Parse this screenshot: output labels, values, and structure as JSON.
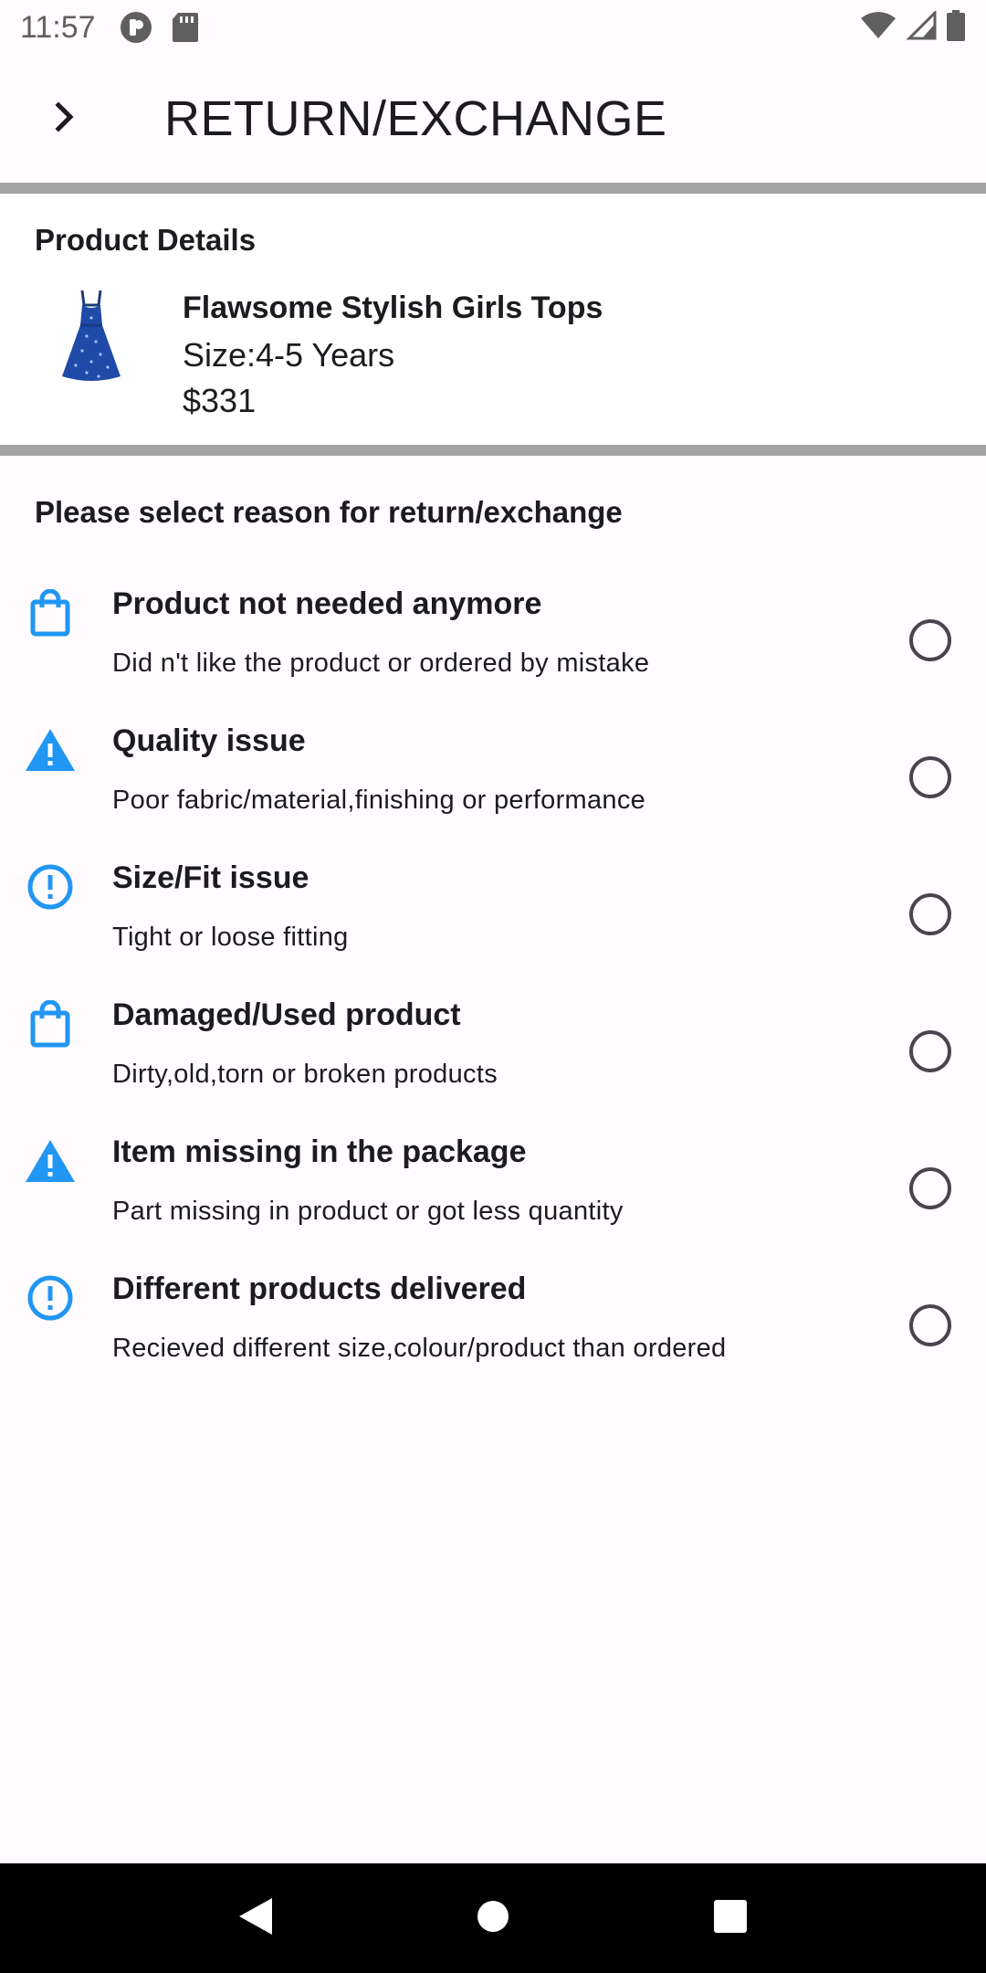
{
  "status_bar": {
    "time": "11:57",
    "icons": [
      "record-icon",
      "sd-card-icon",
      "wifi-icon",
      "signal-icon",
      "battery-icon"
    ]
  },
  "app_bar": {
    "back_icon": "chevron-right-icon",
    "title": "RETURN/EXCHANGE"
  },
  "product": {
    "heading": "Product Details",
    "name": "Flawsome Stylish Girls Tops",
    "size": "Size:4-5 Years",
    "price": "$331"
  },
  "reasons": {
    "heading": "Please select reason for return/exchange",
    "items": [
      {
        "icon": "shopping-bag-icon",
        "title": "Product not needed anymore",
        "subtitle": "Did n't like the product or ordered by mistake",
        "selected": false
      },
      {
        "icon": "warning-icon",
        "title": "Quality issue",
        "subtitle": "Poor fabric/material,finishing or performance",
        "selected": false
      },
      {
        "icon": "error-circle-icon",
        "title": "Size/Fit issue",
        "subtitle": "Tight or loose fitting",
        "selected": false
      },
      {
        "icon": "shopping-bag-icon",
        "title": "Damaged/Used product",
        "subtitle": "Dirty,old,torn or broken products",
        "selected": false
      },
      {
        "icon": "warning-icon",
        "title": "Item missing in the package",
        "subtitle": "Part missing in product or got less quantity",
        "selected": false
      },
      {
        "icon": "error-circle-icon",
        "title": "Different products delivered",
        "subtitle": "Recieved different size,colour/product than ordered",
        "selected": false
      }
    ]
  },
  "colors": {
    "accent": "#2196f3",
    "divider": "#a3a3a3",
    "background": "#fffbfe",
    "radio_border": "#49454f"
  },
  "nav_bar": {
    "icons": [
      "back-triangle-icon",
      "home-circle-icon",
      "recents-square-icon"
    ]
  }
}
